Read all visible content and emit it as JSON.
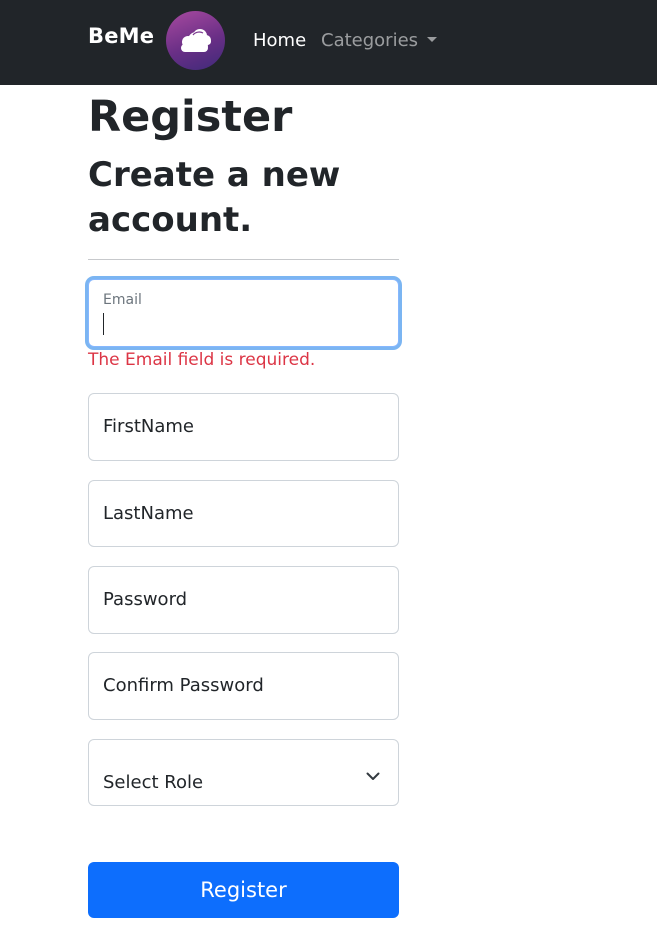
{
  "navbar": {
    "brand": "BeMe",
    "logo_icon": "cloud-icon",
    "links": {
      "home": "Home",
      "categories": "Categories"
    }
  },
  "page": {
    "title": "Register",
    "subtitle": "Create a new account."
  },
  "form": {
    "email": {
      "label": "Email",
      "value": "",
      "error": "The Email field is required."
    },
    "first_name": {
      "placeholder": "FirstName"
    },
    "last_name": {
      "placeholder": "LastName"
    },
    "password": {
      "placeholder": "Password"
    },
    "confirm_password": {
      "placeholder": "Confirm Password"
    },
    "role": {
      "selected": "Select Role"
    },
    "submit_label": "Register"
  },
  "colors": {
    "navbar_bg": "#212529",
    "primary": "#0d6efd",
    "error": "#dc3545",
    "focus_ring": "#86b7fe"
  }
}
